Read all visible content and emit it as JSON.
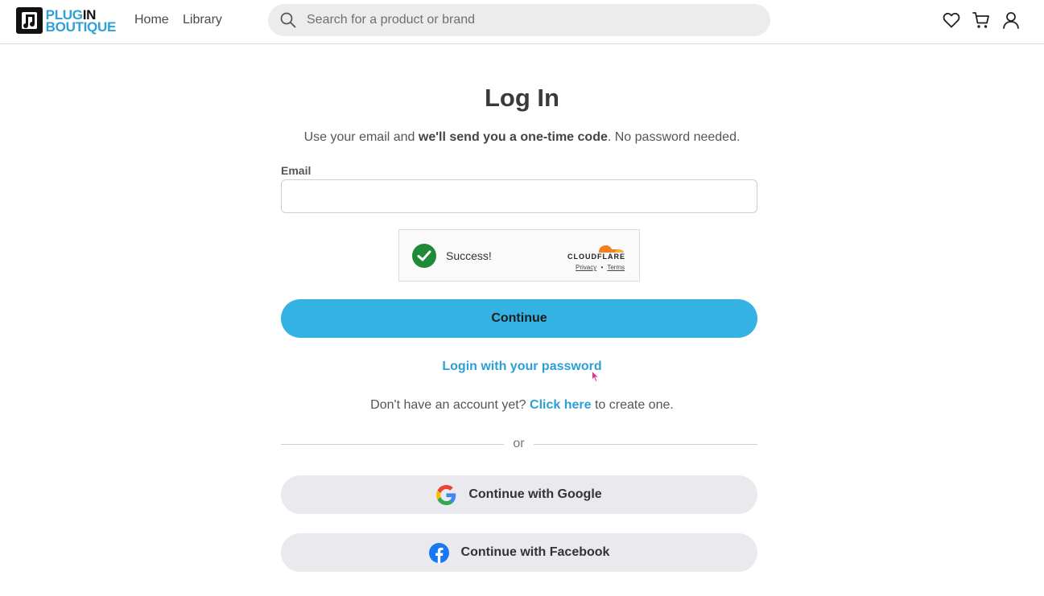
{
  "header": {
    "logo": {
      "line1_a": "PLUG",
      "line1_b": "IN",
      "line2": "BOUTIQUE"
    },
    "nav": [
      {
        "label": "Home"
      },
      {
        "label": "Library"
      }
    ],
    "search": {
      "placeholder": "Search for a product or brand",
      "value": ""
    },
    "icons": [
      "heart-icon",
      "cart-icon",
      "user-icon"
    ]
  },
  "main": {
    "title": "Log In",
    "subtitle": {
      "pre": "Use your email and ",
      "bold": "we'll send you a one-time code",
      "post": ". No password needed."
    },
    "email": {
      "label": "Email",
      "value": "",
      "placeholder": ""
    },
    "turnstile": {
      "status": "Success!",
      "brand": "CLOUDFLARE",
      "privacy": "Privacy",
      "separator": "•",
      "terms": "Terms"
    },
    "continue_label": "Continue",
    "password_link": "Login with your password",
    "signup": {
      "pre": "Don't have an account yet? ",
      "link": "Click here",
      "post": " to create one."
    },
    "divider_text": "or",
    "google_label": "Continue with Google",
    "facebook_label": "Continue with Facebook"
  },
  "colors": {
    "accent": "#35b2e4",
    "link": "#2b9fd6",
    "brand_blue": "#2d9fd9",
    "success": "#1f8a37",
    "facebook": "#1877f2"
  }
}
